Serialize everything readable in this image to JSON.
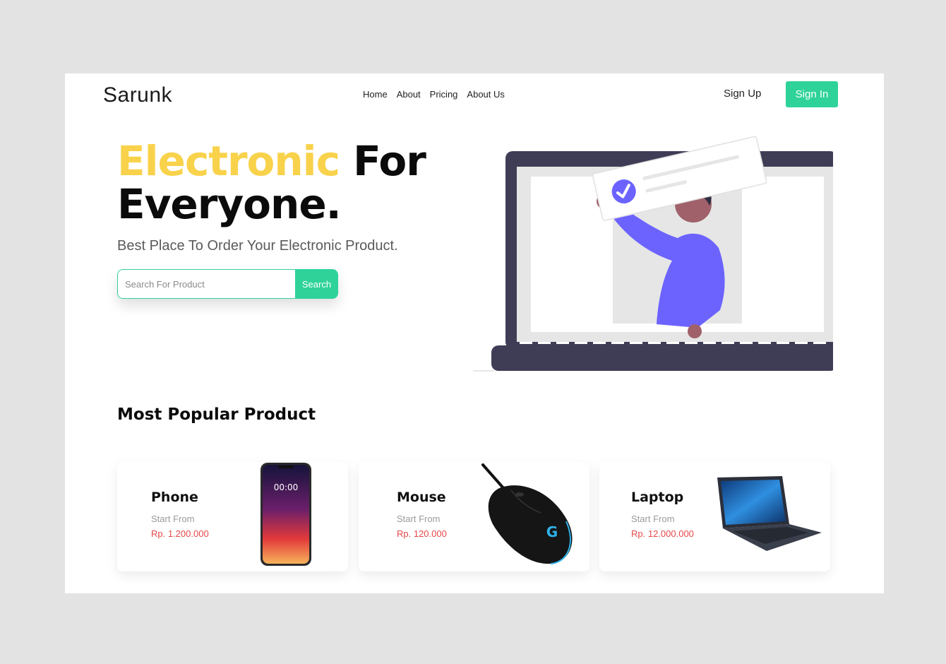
{
  "brand": {
    "name": "Sarunk"
  },
  "nav": {
    "links": [
      "Home",
      "About",
      "Pricing",
      "About Us"
    ],
    "sign_up": "Sign Up",
    "sign_in": "Sign In"
  },
  "hero": {
    "title_accent": "Electronic",
    "title_line1_rest": " For",
    "title_line2": "Everyone.",
    "subtitle": "Best Place To Order Your Electronic Product.",
    "search_placeholder": "Search For Product",
    "search_value": "",
    "search_button": "Search"
  },
  "popular": {
    "title": "Most Popular Product",
    "products": [
      {
        "name": "Phone",
        "from_label": "Start From",
        "price": "Rp. 1.200.000",
        "icon": "phone-icon",
        "screen_time": "00:00"
      },
      {
        "name": "Mouse",
        "from_label": "Start From",
        "price": "Rp. 120.000",
        "icon": "mouse-icon"
      },
      {
        "name": "Laptop",
        "from_label": "Start From",
        "price": "Rp. 12.000.000",
        "icon": "laptop-icon"
      }
    ]
  },
  "colors": {
    "accent_green": "#2fd39a",
    "accent_yellow": "#f9d24b",
    "price_red": "#e64848",
    "illustration_dark": "#3f3d56",
    "illustration_purple": "#6c63ff"
  }
}
